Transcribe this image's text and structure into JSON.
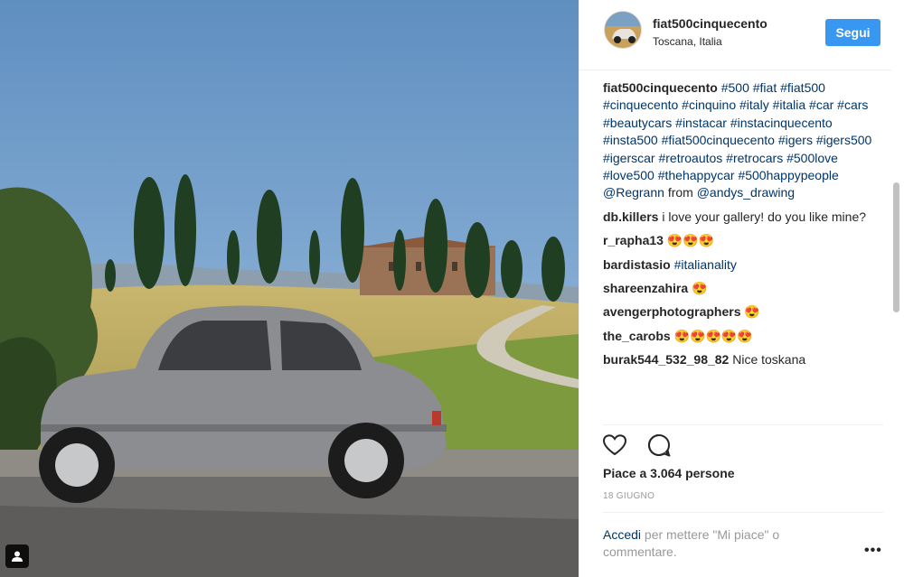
{
  "post": {
    "username": "fiat500cinquecento",
    "location": "Toscana, Italia",
    "follow_label": "Segui",
    "caption_author": "fiat500cinquecento",
    "caption_hashtags": "#500 #fiat #fiat500 #cinquecento #cinquino #italy #italia #car #cars #beautycars #instacar #instacinquecento #insta500 #fiat500cinquecento #igers #igers500 #igerscar #retroautos #retrocars #500love #love500 #thehappycar #500happypeople @Regrann",
    "caption_from": "from",
    "caption_credit": "@andys_drawing",
    "likes_text": "Piace a 3.064 persone",
    "date_text": "18 GIUGNO",
    "login_link": "Accedi",
    "login_text": "per mettere \"Mi piace\" o commentare.",
    "more_glyph": "•••"
  },
  "comments": [
    {
      "author": "db.killers",
      "text": "i love your gallery! do you like mine?"
    },
    {
      "author": "r_rapha13",
      "text": "😍😍😍"
    },
    {
      "author": "bardistasio",
      "tag": "#italianality"
    },
    {
      "author": "shareenzahira",
      "text": "😍"
    },
    {
      "author": "avengerphotographers",
      "text": "😍"
    },
    {
      "author": "the_carobs",
      "text": "😍😍😍😍😍"
    },
    {
      "author": "burak544_532_98_82",
      "text": "Nice toskana"
    }
  ],
  "icons": {
    "like": "heart-icon",
    "comment": "speech-bubble-icon",
    "photo_user": "user-tag-icon",
    "more": "more-options-icon"
  },
  "colors": {
    "accent": "#3897f0",
    "link": "#003569",
    "muted": "#999999",
    "text": "#262626"
  }
}
